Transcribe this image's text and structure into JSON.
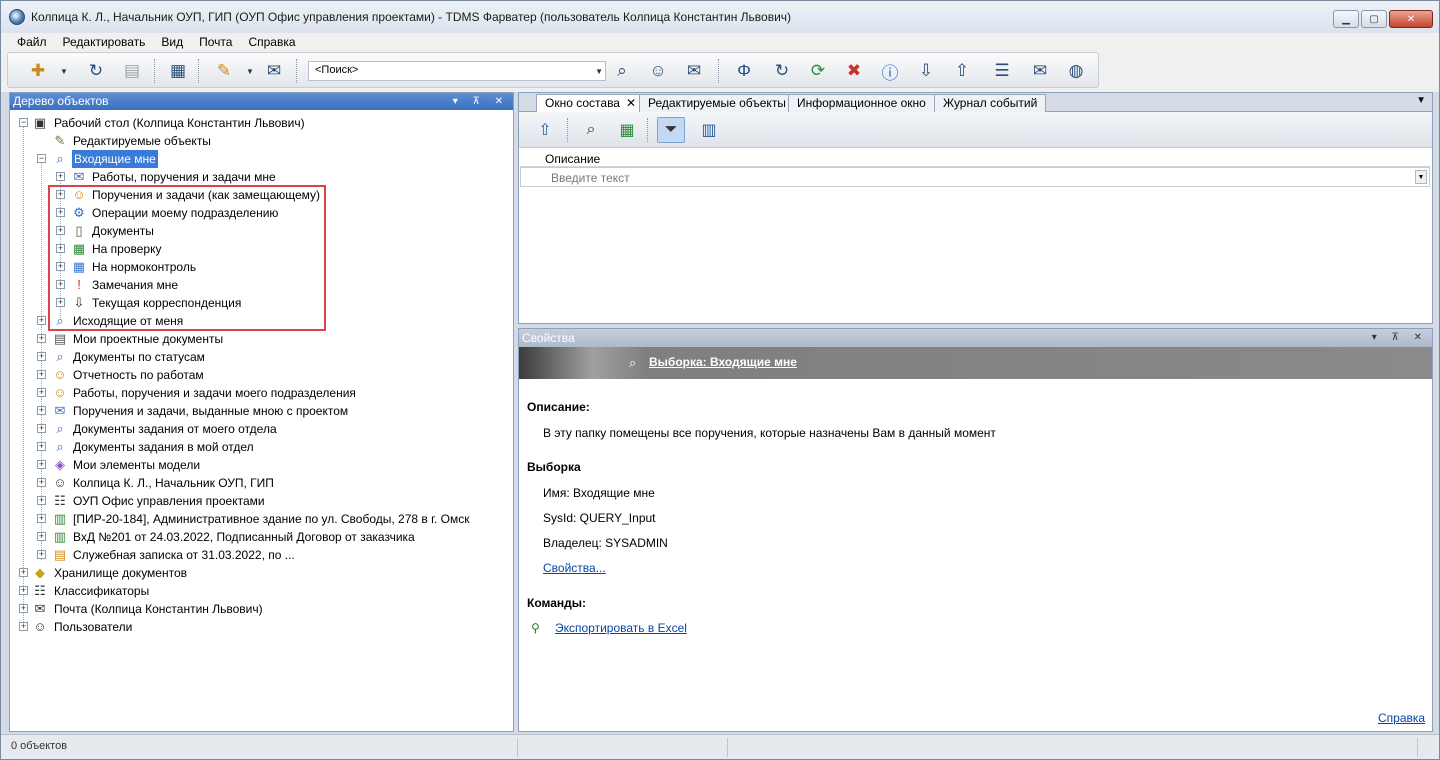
{
  "window": {
    "title": "Колпица К. Л., Начальник ОУП, ГИП (ОУП Офис управления проектами) - TDMS Фарватер (пользователь Колпица Константин Львович)"
  },
  "menu": [
    "Файл",
    "Редактировать",
    "Вид",
    "Почта",
    "Справка"
  ],
  "toolbar": {
    "search_value": "<Поиск>"
  },
  "left_panel": {
    "title": "Дерево объектов",
    "tree": [
      {
        "label": "Рабочий стол (Колпица Константин Львович)",
        "icon": "desktop-icon"
      },
      {
        "label": "Редактируемые объекты",
        "icon": "edit-objects-icon"
      },
      {
        "label": "Входящие мне",
        "icon": "incoming-query-icon"
      },
      {
        "label": "Работы, поручения и задачи мне",
        "icon": "tasks-icon"
      },
      {
        "label": "Поручения и задачи (как замещающему)",
        "icon": "deputy-tasks-icon"
      },
      {
        "label": "Операции моему подразделению",
        "icon": "department-ops-icon"
      },
      {
        "label": "Документы",
        "icon": "document-icon"
      },
      {
        "label": "На проверку",
        "icon": "review-icon"
      },
      {
        "label": "На нормоконтроль",
        "icon": "norm-control-icon"
      },
      {
        "label": "Замечания мне",
        "icon": "remarks-icon"
      },
      {
        "label": "Текущая корреспонденция",
        "icon": "correspondence-icon"
      },
      {
        "label": "Исходящие от меня",
        "icon": "outgoing-query-icon"
      },
      {
        "label": "Мои проектные документы",
        "icon": "project-docs-icon"
      },
      {
        "label": "Документы по статусам",
        "icon": "status-docs-icon"
      },
      {
        "label": "Отчетность по работам",
        "icon": "reports-icon"
      },
      {
        "label": "Работы, поручения и задачи моего подразделения",
        "icon": "dept-tasks-icon"
      },
      {
        "label": "Поручения и задачи, выданные мною с проектом",
        "icon": "issued-tasks-icon"
      },
      {
        "label": "Документы задания от моего отдела",
        "icon": "dept-assign-docs-icon"
      },
      {
        "label": "Документы задания в мой отдел",
        "icon": "incoming-assign-docs-icon"
      },
      {
        "label": "Мои элементы модели",
        "icon": "model-elements-icon"
      },
      {
        "label": "Колпица К. Л., Начальник ОУП, ГИП",
        "icon": "user-role-icon"
      },
      {
        "label": "ОУП Офис управления проектами",
        "icon": "org-structure-icon"
      },
      {
        "label": "[ПИР-20-184], Административное здание по ул. Свободы, 278 в г. Омск",
        "icon": "project-icon"
      },
      {
        "label": "ВхД №201 от 24.03.2022, Подписанный Договор от заказчика",
        "icon": "incoming-doc-icon"
      },
      {
        "label": "Служебная записка от 31.03.2022, по ...",
        "icon": "memo-icon"
      },
      {
        "label": "Хранилище документов",
        "icon": "storage-icon"
      },
      {
        "label": "Классификаторы",
        "icon": "classifiers-icon"
      },
      {
        "label": "Почта (Колпица Константин Львович)",
        "icon": "mail-icon"
      },
      {
        "label": "Пользователи",
        "icon": "users-icon"
      }
    ]
  },
  "right_top": {
    "tabs": [
      "Окно состава",
      "Редактируемые объекты",
      "Информационное окно",
      "Журнал событий"
    ],
    "grid": {
      "column": "Описание",
      "filter_placeholder": "Введите текст"
    }
  },
  "properties": {
    "title": "Свойства",
    "banner_link": "Выборка: Входящие мне",
    "description_head": "Описание:",
    "description_text": "В эту папку помещены все поручения, которые назначены Вам в данный момент",
    "selection_head": "Выборка",
    "name_line": "Имя: Входящие мне",
    "sysid_line": "SysId: QUERY_Input",
    "owner_line": "Владелец: SYSADMIN",
    "properties_link": "Свойства...",
    "commands_head": "Команды:",
    "export_link": "Экспортировать в Excel",
    "help_link": "Справка"
  },
  "status": {
    "objects": "0 объектов"
  }
}
